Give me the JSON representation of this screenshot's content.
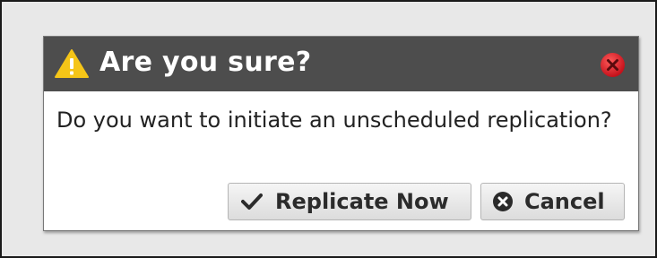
{
  "dialog": {
    "title": "Are you sure?",
    "message": "Do you want to initiate an unscheduled replication?",
    "icons": {
      "title": "warning-icon",
      "close": "close-icon",
      "confirm": "checkmark-icon",
      "cancel": "cancel-circle-icon"
    },
    "buttons": {
      "confirm_label": "Replicate Now",
      "cancel_label": "Cancel"
    }
  },
  "colors": {
    "titlebar": "#4d4d4d",
    "warning": "#f5c518",
    "close": "#e2202a",
    "background": "#e8e8e8"
  }
}
